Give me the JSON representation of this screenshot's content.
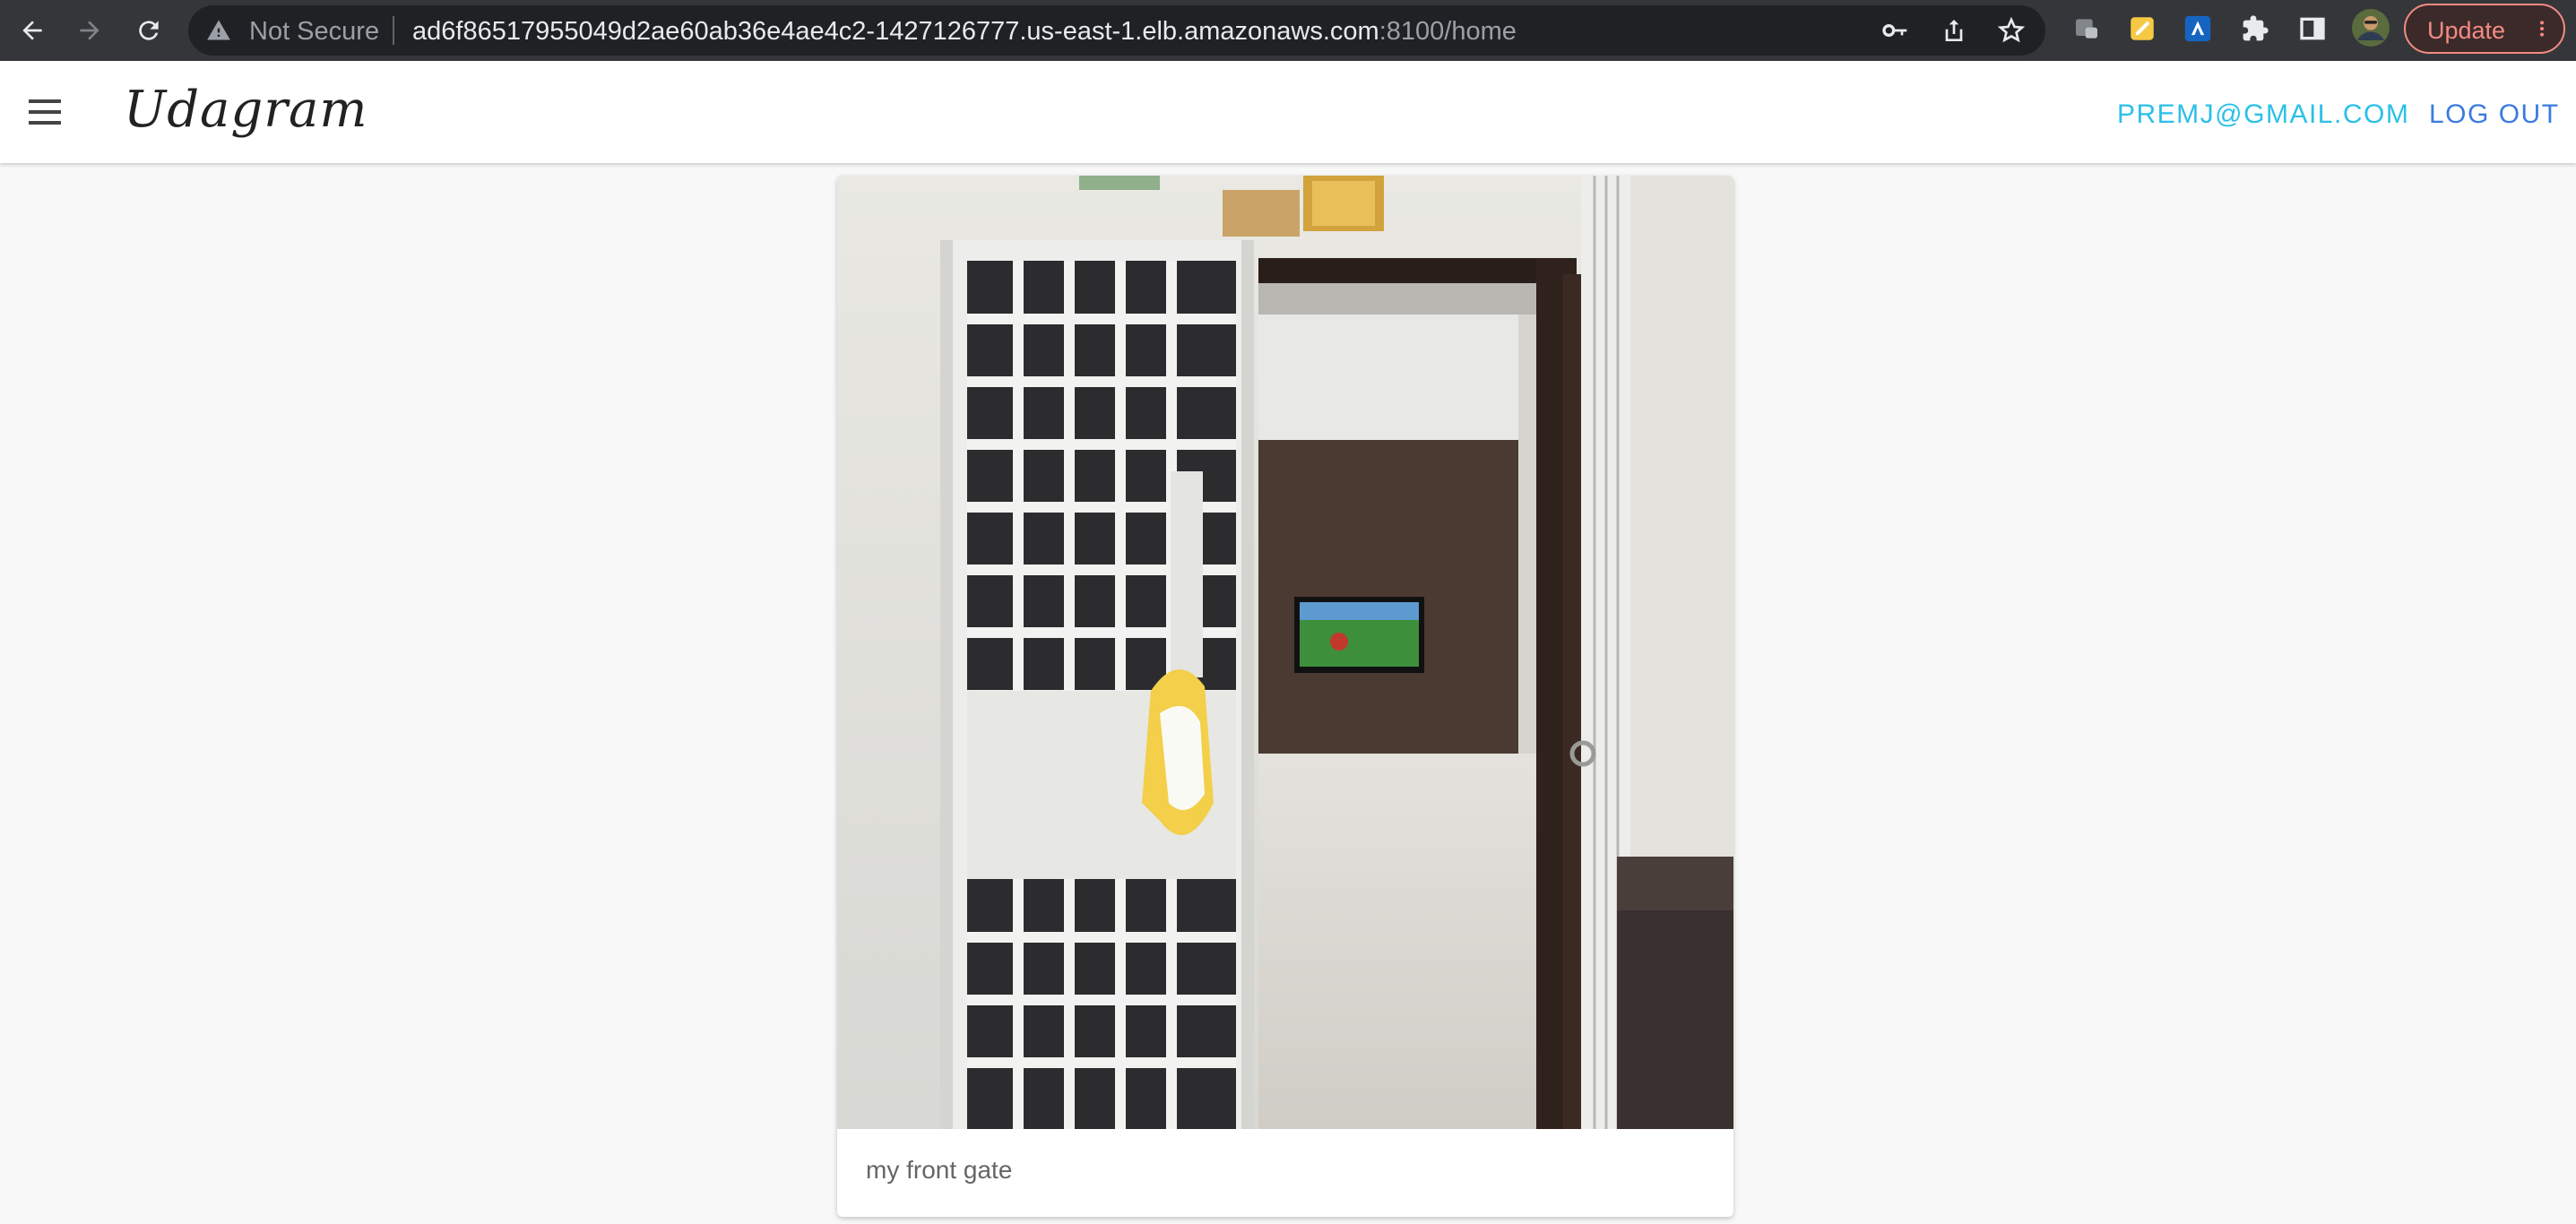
{
  "browser": {
    "security_label": "Not Secure",
    "url_host": "ad6f86517955049d2ae60ab36e4ae4c2-1427126777.us-east-1.elb.amazonaws.com",
    "url_path": ":8100/home",
    "update_label": "Update",
    "icons": [
      "back-arrow-icon",
      "forward-arrow-icon",
      "reload-icon",
      "warning-icon",
      "key-icon",
      "share-icon",
      "star-icon",
      "extension-icon",
      "puzzle-icon",
      "side-panel-icon",
      "profile-avatar",
      "more-vert-icon"
    ]
  },
  "app": {
    "brand": "Udagram",
    "user_email": "PREMJ@GMAIL.COM",
    "logout_label": "LOG OUT",
    "colors": {
      "email_link": "#2bc0e8",
      "logout_link": "#3a7be0"
    }
  },
  "feed": {
    "items": [
      {
        "caption": "my front gate"
      }
    ]
  }
}
